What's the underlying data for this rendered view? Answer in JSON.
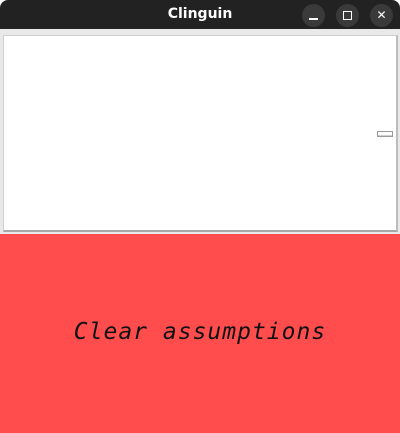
{
  "window": {
    "title": "Clinguin",
    "controls": {
      "minimize_icon": "minimize-icon",
      "maximize_icon": "maximize-icon",
      "close_icon": "close-icon",
      "close_glyph": "✕"
    }
  },
  "main": {
    "clear_button_label": "Clear assumptions",
    "clear_button_color": "#ff4d4d"
  }
}
